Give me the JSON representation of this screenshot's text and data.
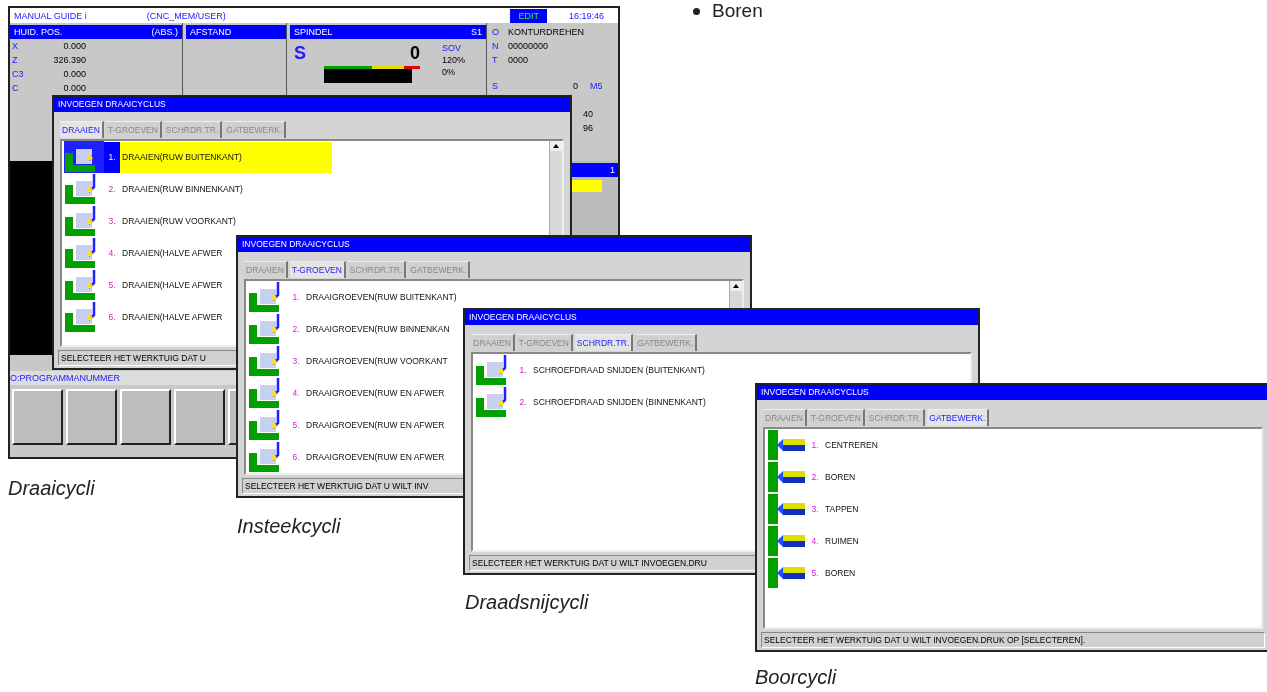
{
  "bullet": "Boren",
  "cnc": {
    "mode": "MANUAL GUIDE i",
    "path": "(CNC_MEM/USER)",
    "status": "EDIT",
    "time": "16:19:46",
    "position": {
      "title": "HUID. POS.",
      "mode": "(ABS.)",
      "axes": [
        {
          "axis": "X",
          "value": "0.000"
        },
        {
          "axis": "Z",
          "value": "326.390"
        },
        {
          "axis": "C3",
          "value": "0.000"
        },
        {
          "axis": "C",
          "value": "0.000"
        }
      ]
    },
    "distance": {
      "title": "AFSTAND"
    },
    "spindle": {
      "title": "SPINDEL",
      "channel": "S1",
      "label": "S",
      "speed": "0",
      "override_label": "SOV",
      "override": "120%",
      "load": "0%"
    },
    "program": [
      {
        "key": "O",
        "value": "KONTURDREHEN"
      },
      {
        "key": "N",
        "value": "00000000"
      },
      {
        "key": "T",
        "value": "0000"
      }
    ],
    "spindle_state": {
      "key": "S",
      "value": "0",
      "code": "M5"
    },
    "values": [
      "40",
      "96"
    ],
    "tool_number": "1",
    "prompt": "O:PROGRAMMANUMMER"
  },
  "dialogs": [
    {
      "title": "INVOEGEN DRAAICYCLUS",
      "caption": "Draaicycli",
      "tabs": [
        {
          "label": "DRAAIEN",
          "selected": true
        },
        {
          "label": "T-GROEVEN",
          "selected": false
        },
        {
          "label": "SCHRDR.TR.",
          "selected": false
        },
        {
          "label": "GATBEWERK.",
          "selected": false
        }
      ],
      "items": [
        {
          "number": "1.",
          "label": "DRAAIEN(RUW BUITENKANT)",
          "selected": true
        },
        {
          "number": "2.",
          "label": "DRAAIEN(RUW BINNENKANT)",
          "selected": false
        },
        {
          "number": "3.",
          "label": "DRAAIEN(RUW VOORKANT)",
          "selected": false
        },
        {
          "number": "4.",
          "label": "DRAAIEN(HALVE AFWER",
          "selected": false
        },
        {
          "number": "5.",
          "label": "DRAAIEN(HALVE AFWER",
          "selected": false
        },
        {
          "number": "6.",
          "label": "DRAAIEN(HALVE AFWER",
          "selected": false
        }
      ],
      "status": "SELECTEER HET WERKTUIG DAT U"
    },
    {
      "title": "INVOEGEN DRAAICYCLUS",
      "caption": "Insteekcycli",
      "tabs": [
        {
          "label": "DRAAIEN",
          "selected": false
        },
        {
          "label": "T-GROEVEN",
          "selected": true
        },
        {
          "label": "SCHRDR.TR.",
          "selected": false
        },
        {
          "label": "GATBEWERK.",
          "selected": false
        }
      ],
      "items": [
        {
          "number": "1.",
          "label": "DRAAIGROEVEN(RUW BUITENKANT)",
          "selected": false
        },
        {
          "number": "2.",
          "label": "DRAAIGROEVEN(RUW BINNENKAN",
          "selected": false
        },
        {
          "number": "3.",
          "label": "DRAAIGROEVEN(RUW VOORKANT",
          "selected": false
        },
        {
          "number": "4.",
          "label": "DRAAIGROEVEN(RUW EN AFWER",
          "selected": false
        },
        {
          "number": "5.",
          "label": "DRAAIGROEVEN(RUW EN AFWER",
          "selected": false
        },
        {
          "number": "6.",
          "label": "DRAAIGROEVEN(RUW EN AFWER",
          "selected": false
        }
      ],
      "status": "SELECTEER HET WERKTUIG DAT U WILT INV"
    },
    {
      "title": "INVOEGEN DRAAICYCLUS",
      "caption": "Draadsnijcycli",
      "tabs": [
        {
          "label": "DRAAIEN",
          "selected": false
        },
        {
          "label": "T-GROEVEN",
          "selected": false
        },
        {
          "label": "SCHRDR.TR.",
          "selected": true
        },
        {
          "label": "GATBEWERK.",
          "selected": false
        }
      ],
      "items": [
        {
          "number": "1.",
          "label": "SCHROEFDRAAD SNIJDEN (BUITENKANT)",
          "selected": false
        },
        {
          "number": "2.",
          "label": "SCHROEFDRAAD SNIJDEN (BINNENKANT)",
          "selected": false
        }
      ],
      "status": "SELECTEER HET WERKTUIG DAT U WILT INVOEGEN.DRU"
    },
    {
      "title": "INVOEGEN DRAAICYCLUS",
      "caption": "Boorcycli",
      "tabs": [
        {
          "label": "DRAAIEN",
          "selected": false
        },
        {
          "label": "T-GROEVEN",
          "selected": false
        },
        {
          "label": "SCHRDR.TR.",
          "selected": false
        },
        {
          "label": "GATBEWERK.",
          "selected": true
        }
      ],
      "items": [
        {
          "number": "1.",
          "label": "CENTREREN",
          "selected": false
        },
        {
          "number": "2.",
          "label": "BOREN",
          "selected": false
        },
        {
          "number": "3.",
          "label": "TAPPEN",
          "selected": false
        },
        {
          "number": "4.",
          "label": "RUIMEN",
          "selected": false
        },
        {
          "number": "5.",
          "label": "BOREN",
          "selected": false
        }
      ],
      "status": "SELECTEER HET WERKTUIG DAT U WILT INVOEGEN.DRUK OP [SELECTEREN]."
    }
  ]
}
